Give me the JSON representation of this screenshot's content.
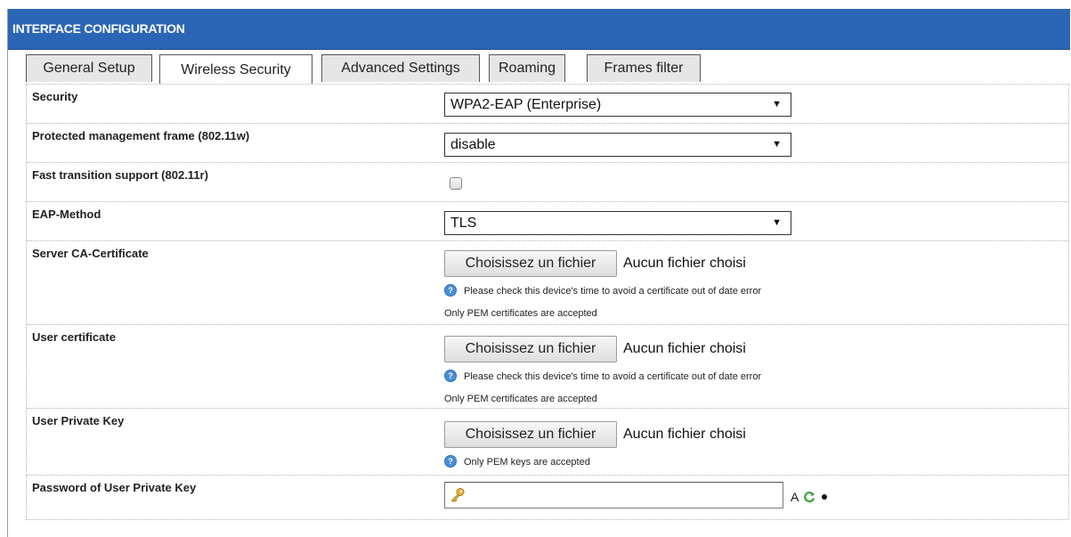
{
  "panel": {
    "title": "INTERFACE CONFIGURATION"
  },
  "tabs": [
    {
      "label": "General Setup",
      "active": false
    },
    {
      "label": "Wireless Security",
      "active": true
    },
    {
      "label": "Advanced Settings",
      "active": false
    },
    {
      "label": "Roaming",
      "active": false
    },
    {
      "label": "Frames filter",
      "active": false
    }
  ],
  "form": {
    "security": {
      "label": "Security",
      "selected": "WPA2-EAP (Enterprise)"
    },
    "pmf": {
      "label": "Protected management frame (802.11w)",
      "selected": "disable"
    },
    "fast_transition": {
      "label": "Fast transition support (802.11r)",
      "checked": false
    },
    "eap_method": {
      "label": "EAP-Method",
      "selected": "TLS"
    },
    "server_ca": {
      "label": "Server CA-Certificate",
      "button": "Choisissez un fichier",
      "status": "Aucun fichier choisi",
      "hint": "Please check this device's time to avoid a certificate out of date error",
      "note": "Only PEM certificates are accepted"
    },
    "user_cert": {
      "label": "User certificate",
      "button": "Choisissez un fichier",
      "status": "Aucun fichier choisi",
      "hint": "Please check this device's time to avoid a certificate out of date error",
      "note": "Only PEM certificates are accepted"
    },
    "user_key": {
      "label": "User Private Key",
      "button": "Choisissez un fichier",
      "status": "Aucun fichier choisi",
      "hint": "Only PEM keys are accepted"
    },
    "key_password": {
      "label": "Password of User Private Key",
      "value": "",
      "tool_text": "A"
    }
  },
  "colors": {
    "title_bar": "#2b66b6",
    "info_icon": "#4a8fd8",
    "regen_icon": "#3aa63a"
  },
  "icons": {
    "dropdown_arrow": "▼",
    "info": "?",
    "key": "key-icon",
    "regenerate": "refresh-icon",
    "show": "dot-icon"
  }
}
